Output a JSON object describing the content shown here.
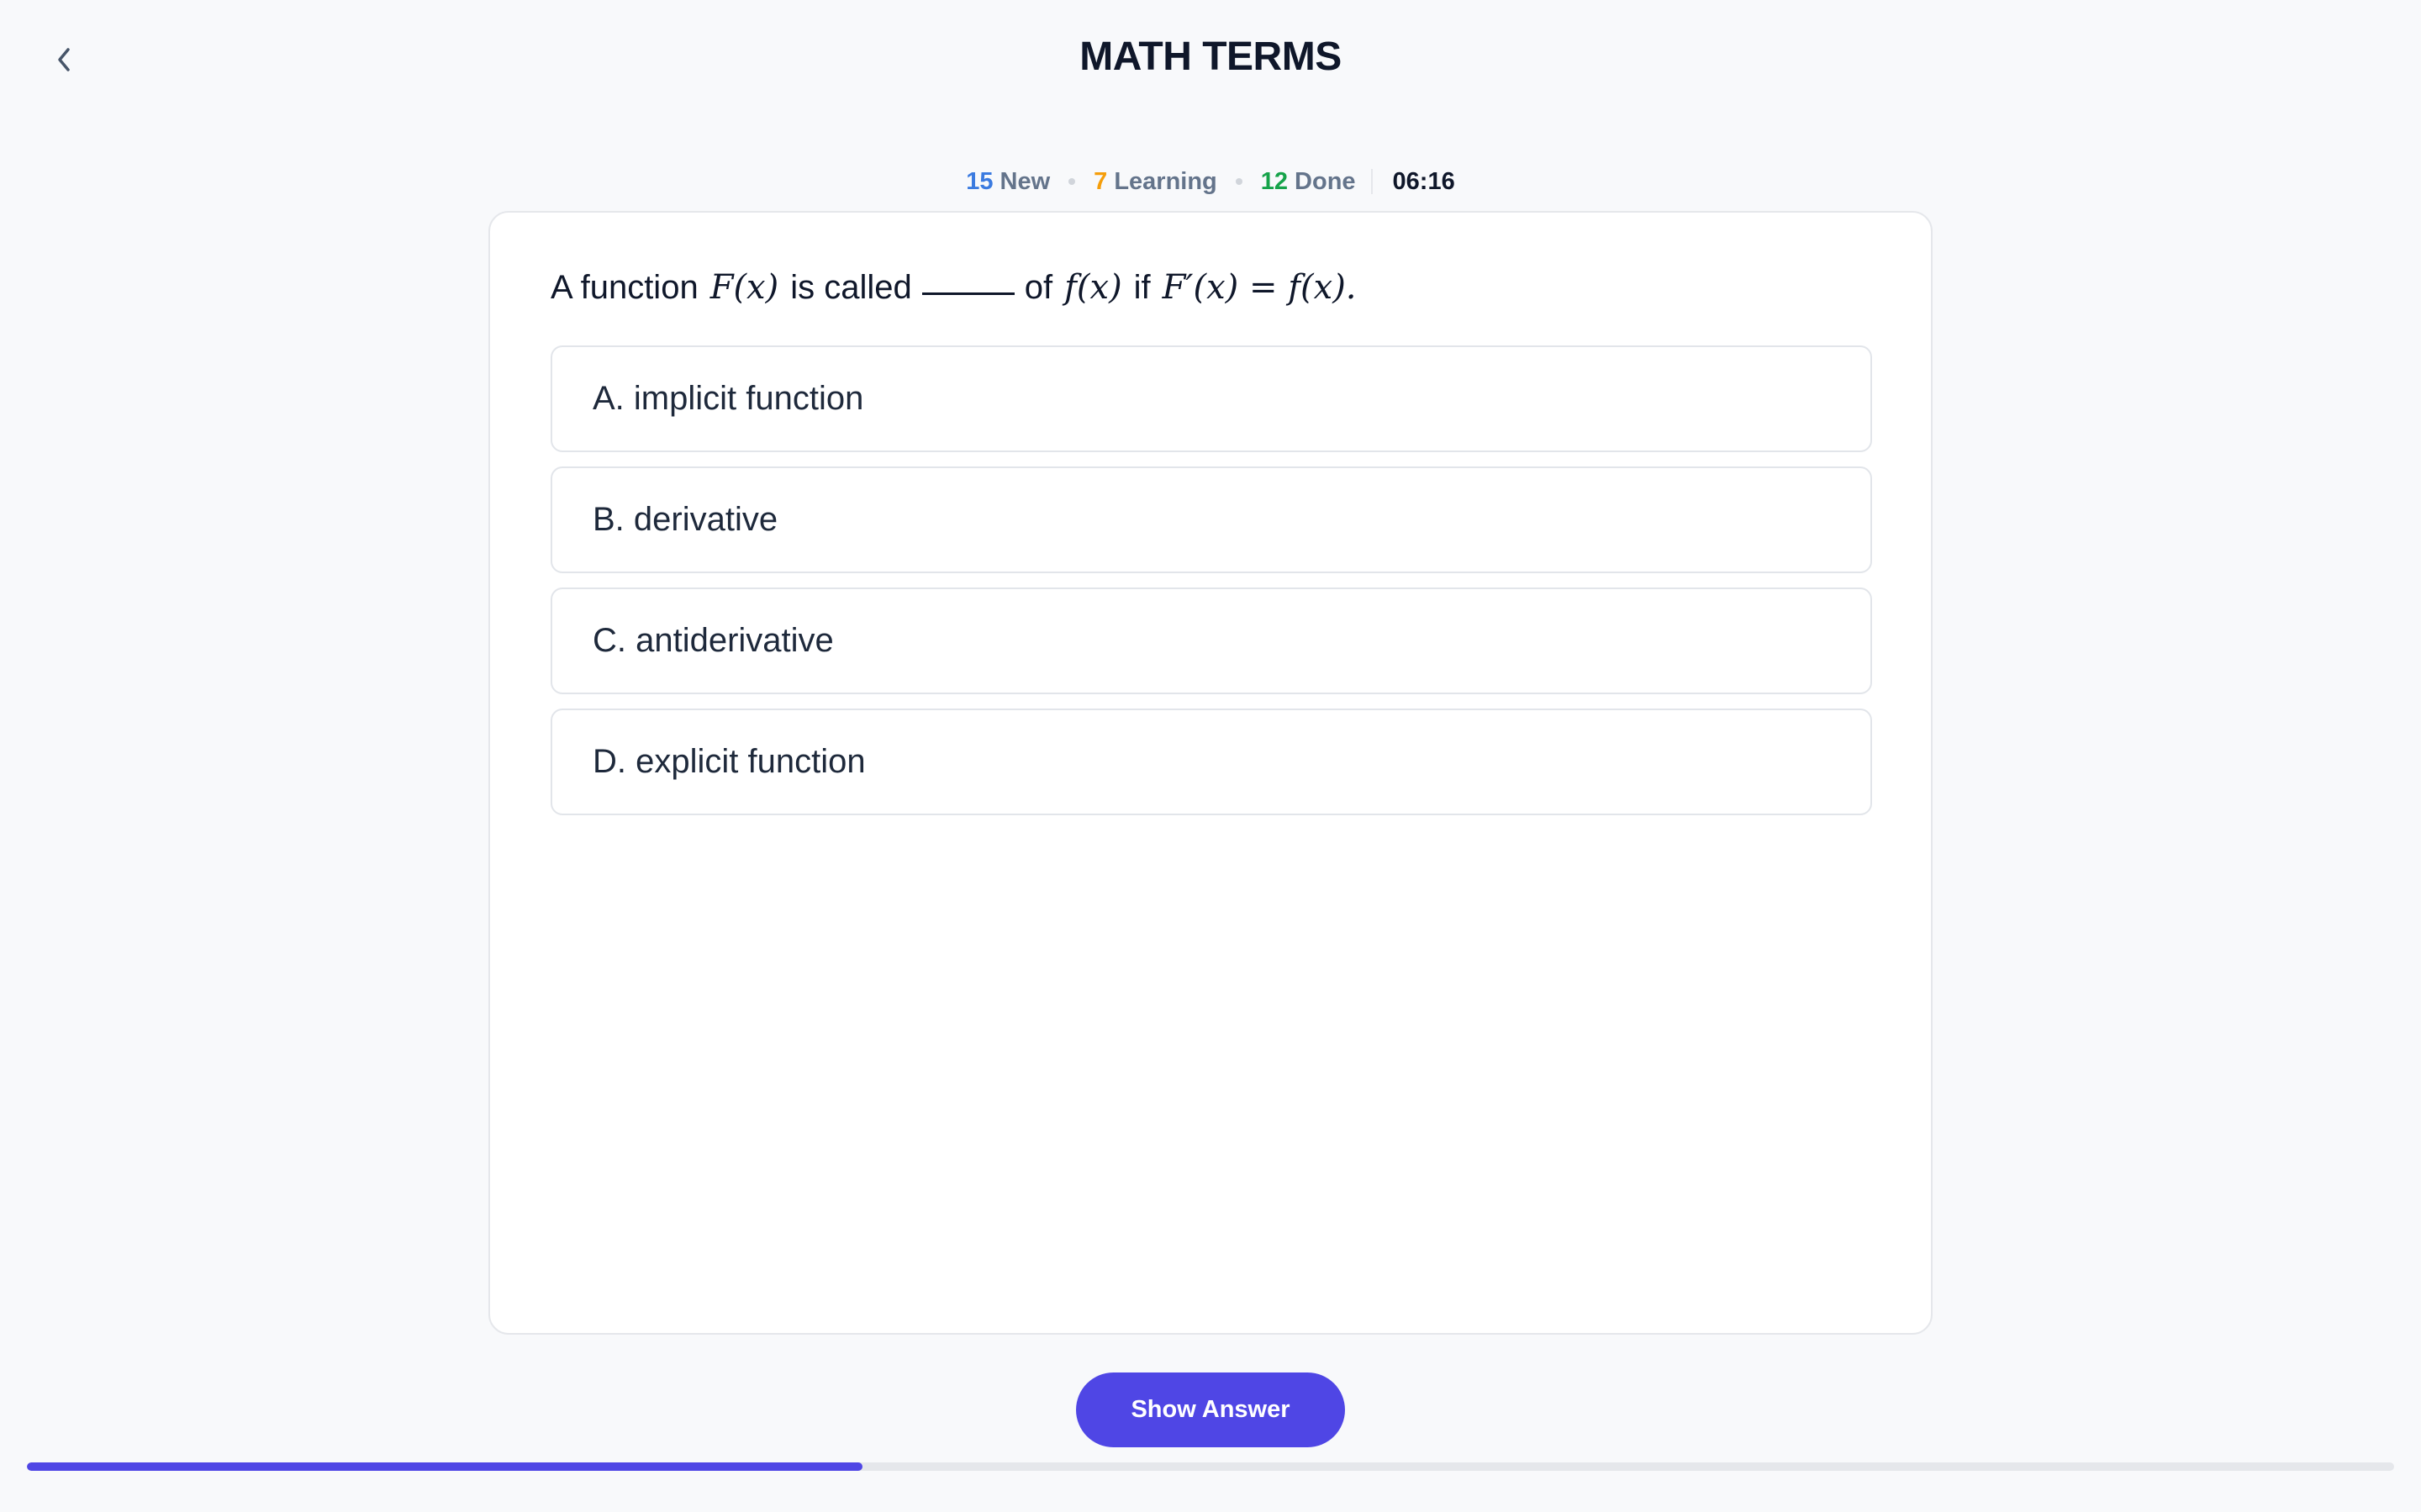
{
  "header": {
    "title": "MATH TERMS",
    "back_icon": "chevron-left-icon"
  },
  "stats": {
    "new_count": "15",
    "new_label": "New",
    "learning_count": "7",
    "learning_label": "Learning",
    "done_count": "12",
    "done_label": "Done",
    "timer": "06:16"
  },
  "question": {
    "part1": "A function",
    "math1": "F(x)",
    "part2": "is called",
    "part3": "of",
    "math2": "f(x)",
    "part4": "if",
    "math3": "F′(x) = f(x)."
  },
  "options": [
    {
      "label": "A. implicit function"
    },
    {
      "label": "B. derivative"
    },
    {
      "label": "C. antiderivative"
    },
    {
      "label": "D. explicit function"
    }
  ],
  "actions": {
    "show_answer": "Show Answer"
  },
  "progress": {
    "fraction": 0.353
  },
  "colors": {
    "accent": "#4f46e5",
    "new": "#3b7be0",
    "learning": "#f59e0b",
    "done": "#16a34a"
  }
}
